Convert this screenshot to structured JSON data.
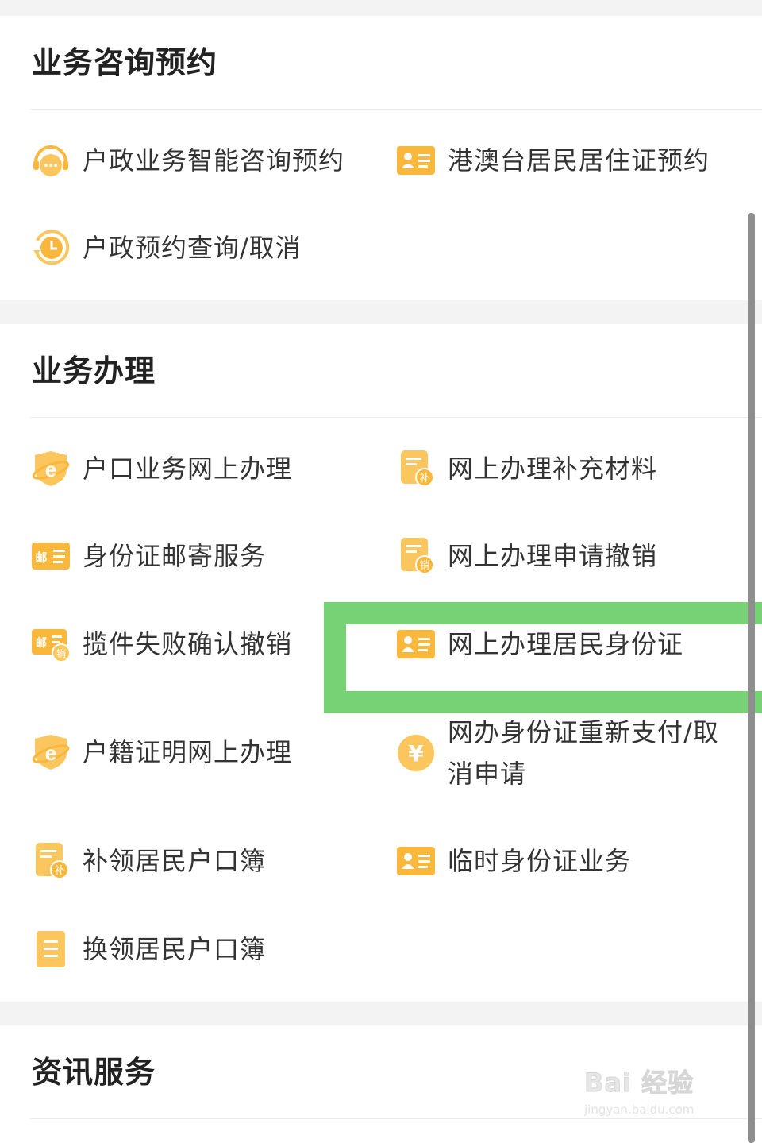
{
  "sections": [
    {
      "title": "业务咨询预约",
      "items": [
        {
          "label": "户政业务智能咨询预约",
          "icon": "headset-chat-icon"
        },
        {
          "label": "港澳台居民居住证预约",
          "icon": "id-card-icon"
        },
        {
          "label": "户政预约查询/取消",
          "icon": "clock-refresh-icon"
        }
      ]
    },
    {
      "title": "业务办理",
      "items": [
        {
          "label": "户口业务网上办理",
          "icon": "e-service-icon"
        },
        {
          "label": "网上办理补充材料",
          "icon": "form-supplement-icon",
          "badge": "补"
        },
        {
          "label": "身份证邮寄服务",
          "icon": "mail-icon",
          "badge": "邮"
        },
        {
          "label": "网上办理申请撤销",
          "icon": "form-cancel-icon",
          "badge": "销"
        },
        {
          "label": "揽件失败确认撤销",
          "icon": "mail-cancel-icon",
          "badge": "邮",
          "badge2": "销"
        },
        {
          "label": "网上办理居民身份证",
          "icon": "id-card-icon"
        },
        {
          "label": "户籍证明网上办理",
          "icon": "e-service-icon"
        },
        {
          "label": "网办身份证重新支付/取消申请",
          "icon": "yuan-coin-icon",
          "badge": "¥"
        },
        {
          "label": "补领居民户口簿",
          "icon": "form-supplement-icon",
          "badge": "补"
        },
        {
          "label": "临时身份证业务",
          "icon": "id-card-icon"
        },
        {
          "label": "换领居民户口簿",
          "icon": "booklet-icon"
        }
      ]
    },
    {
      "title": "资讯服务",
      "items": []
    }
  ],
  "watermark": {
    "main": "Bai 经验",
    "sub": "jingyan.baidu.com"
  },
  "colors": {
    "accent": "#f9b73c",
    "highlight": "#77d275",
    "title": "#222222",
    "text": "#333333"
  }
}
